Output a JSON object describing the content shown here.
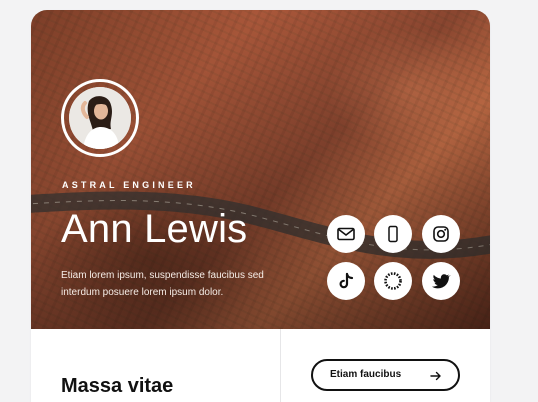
{
  "profile": {
    "role": "ASTRAL ENGINEER",
    "name": "Ann Lewis",
    "bio": "Etiam lorem ipsum, suspendisse faucibus sed interdum posuere lorem ipsum dolor."
  },
  "socials": [
    {
      "icon": "mail-icon"
    },
    {
      "icon": "phone-icon"
    },
    {
      "icon": "instagram-icon"
    },
    {
      "icon": "tiktok-icon"
    },
    {
      "icon": "ring-icon"
    },
    {
      "icon": "twitter-icon"
    }
  ],
  "footer": {
    "title": "Massa vitae",
    "cta_label": "Etiam faucibus"
  },
  "colors": {
    "accent": "#111111",
    "card_bg": "#ffffff",
    "page_bg": "#f3f3f4",
    "hero_tone": "#a9573a"
  }
}
